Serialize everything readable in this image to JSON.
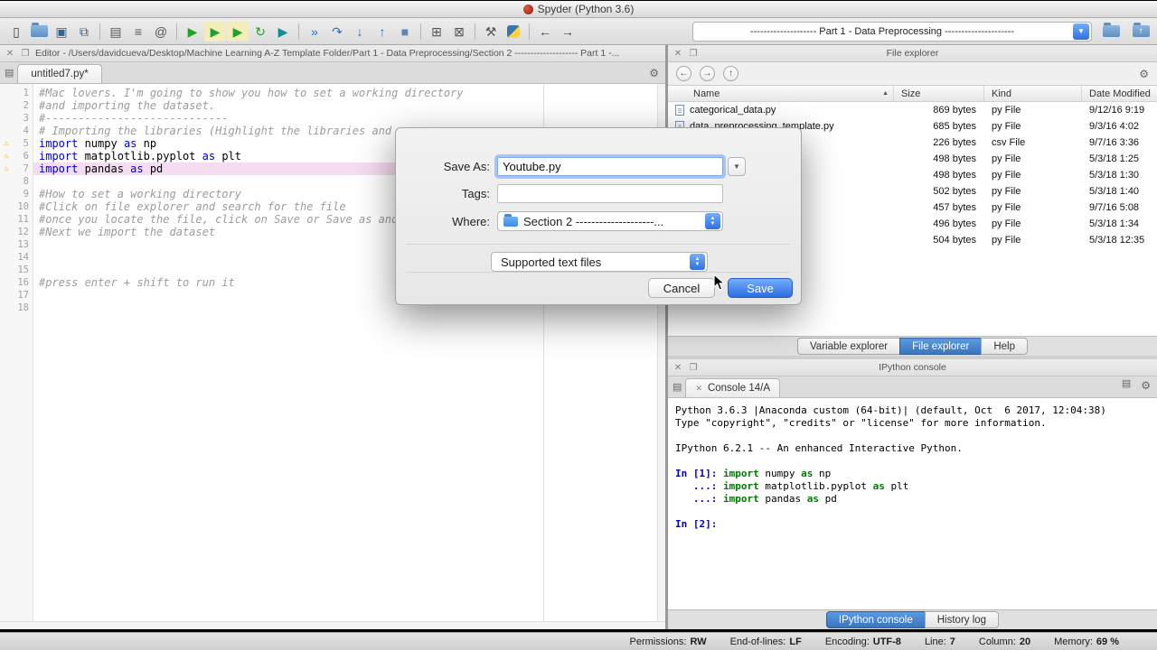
{
  "title_bar": {
    "title": "Spyder (Python 3.6)"
  },
  "colors": {
    "active_tab_blue": "#3a74bd",
    "save_button_blue": "#2d6ce2",
    "highlight_pink": "#f6dcf0",
    "warning_yellow": "#edb200",
    "keyword_blue": "#0000c8",
    "comment_gray": "#9c9c9c",
    "console_keyword_green": "#007a00",
    "prompt_blue": "#0000c8"
  },
  "toolbar": {
    "workdir_combo": "-------------------- Part 1 - Data Preprocessing ---------------------",
    "icons": [
      {
        "name": "new-file-icon",
        "glyph": "▯",
        "color": "#444"
      },
      {
        "name": "open-file-icon",
        "type": "folder"
      },
      {
        "name": "save-icon",
        "glyph": "▣",
        "color": "#33628e"
      },
      {
        "name": "save-all-icon",
        "glyph": "⧉",
        "color": "#33628e"
      },
      {
        "type": "sep"
      },
      {
        "name": "print-icon",
        "glyph": "▤",
        "color": "#555"
      },
      {
        "name": "file-switcher-icon",
        "glyph": "≡",
        "color": "#555"
      },
      {
        "name": "find-in-files-icon",
        "glyph": "@",
        "color": "#555"
      },
      {
        "type": "sep"
      },
      {
        "name": "run-icon",
        "glyph": "▶",
        "color": "#23a127"
      },
      {
        "name": "run-cell-icon",
        "glyph": "▶",
        "color": "#23a127",
        "bg": "#f3edbb"
      },
      {
        "name": "run-cell-advance-icon",
        "glyph": "▶",
        "color": "#23a127",
        "bg": "#f3edbb"
      },
      {
        "name": "rerun-cell-icon",
        "glyph": "↻",
        "color": "#23a127"
      },
      {
        "name": "run-selection-icon",
        "glyph": "▶",
        "color": "#0f8f94"
      },
      {
        "type": "sep"
      },
      {
        "name": "debug-icon",
        "glyph": "»",
        "color": "#2d6fc3"
      },
      {
        "name": "debug-step-icon",
        "glyph": "↷",
        "color": "#2d6fc3"
      },
      {
        "name": "debug-step-into-icon",
        "glyph": "↓",
        "color": "#2d6fc3"
      },
      {
        "name": "debug-step-out-icon",
        "glyph": "↑",
        "color": "#2d6fc3"
      },
      {
        "name": "stop-icon",
        "glyph": "■",
        "color": "#5c87b5"
      },
      {
        "type": "sep"
      },
      {
        "name": "maximize-pane-icon",
        "glyph": "⊞",
        "color": "#555"
      },
      {
        "name": "close-pane-icon",
        "glyph": "⊠",
        "color": "#555"
      },
      {
        "type": "sep"
      },
      {
        "name": "preferences-icon",
        "glyph": "⚒",
        "color": "#555"
      },
      {
        "name": "python-path-icon",
        "type": "pylogo"
      },
      {
        "type": "sep"
      },
      {
        "name": "back-icon",
        "glyph": "←",
        "color": "#444"
      },
      {
        "name": "forward-icon",
        "glyph": "→",
        "color": "#444"
      }
    ]
  },
  "editor": {
    "header": "Editor - /Users/davidcueva/Desktop/Machine Learning A-Z Template Folder/Part 1 - Data Preprocessing/Section 2 -------------------- Part 1 -...",
    "tab": "untitled7.py*",
    "lines": [
      {
        "n": 1,
        "seg": [
          [
            "c",
            "#Mac lovers. I'm going to show you how to set a working directory"
          ]
        ]
      },
      {
        "n": 2,
        "seg": [
          [
            "c",
            "#and importing the dataset."
          ]
        ]
      },
      {
        "n": 3,
        "seg": [
          [
            "c",
            "#----------------------------"
          ]
        ]
      },
      {
        "n": 4,
        "seg": [
          [
            "c",
            "# Importing the libraries (Highlight the libraries and p"
          ]
        ]
      },
      {
        "n": 5,
        "w": true,
        "seg": [
          [
            "k",
            "import"
          ],
          [
            "p",
            " numpy "
          ],
          [
            "k",
            "as"
          ],
          [
            "p",
            " np"
          ]
        ]
      },
      {
        "n": 6,
        "w": true,
        "seg": [
          [
            "k",
            "import"
          ],
          [
            "p",
            " matplotlib.pyplot "
          ],
          [
            "k",
            "as"
          ],
          [
            "p",
            " plt"
          ]
        ]
      },
      {
        "n": 7,
        "w": true,
        "h": true,
        "seg": [
          [
            "k",
            "import"
          ],
          [
            "p",
            " pandas "
          ],
          [
            "k",
            "as"
          ],
          [
            "p",
            " pd"
          ]
        ]
      },
      {
        "n": 8,
        "seg": []
      },
      {
        "n": 9,
        "seg": [
          [
            "c",
            "#How to set a working directory"
          ]
        ]
      },
      {
        "n": 10,
        "seg": [
          [
            "c",
            "#Click on file explorer and search for the file"
          ]
        ]
      },
      {
        "n": 11,
        "seg": [
          [
            "c",
            "#once you locate the file, click on Save or Save as and"
          ]
        ]
      },
      {
        "n": 12,
        "seg": [
          [
            "c",
            "#Next we import the dataset"
          ]
        ]
      },
      {
        "n": 13,
        "seg": []
      },
      {
        "n": 14,
        "seg": []
      },
      {
        "n": 15,
        "seg": []
      },
      {
        "n": 16,
        "seg": [
          [
            "c",
            "#press enter + shift to run it"
          ]
        ]
      },
      {
        "n": 17,
        "seg": []
      },
      {
        "n": 18,
        "seg": []
      }
    ]
  },
  "file_explorer": {
    "panel_title": "File explorer",
    "toolbar_icons": [
      {
        "name": "explorer-previous-icon",
        "glyph": "←"
      },
      {
        "name": "explorer-next-icon",
        "glyph": "→"
      },
      {
        "name": "explorer-parent-icon",
        "glyph": "↑"
      }
    ],
    "columns": [
      "Name",
      "Size",
      "Kind",
      "Date Modified"
    ],
    "rows": [
      {
        "name": "categorical_data.py",
        "size": "869 bytes",
        "kind": "py File",
        "date": "9/12/16 9:19"
      },
      {
        "name": "data_preprocessing_template.py",
        "size": "685 bytes",
        "kind": "py File",
        "date": "9/3/16 4:02"
      },
      {
        "name": "",
        "size": "226 bytes",
        "kind": "csv File",
        "date": "9/7/16 3:36"
      },
      {
        "name": "",
        "size": "498 bytes",
        "kind": "py File",
        "date": "5/3/18 1:25"
      },
      {
        "name": "",
        "size": "498 bytes",
        "kind": "py File",
        "date": "5/3/18 1:30"
      },
      {
        "name": "",
        "size": "502 bytes",
        "kind": "py File",
        "date": "5/3/18 1:40"
      },
      {
        "name": "",
        "size": "457 bytes",
        "kind": "py File",
        "date": "9/7/16 5:08"
      },
      {
        "name": "",
        "size": "496 bytes",
        "kind": "py File",
        "date": "5/3/18 1:34"
      },
      {
        "name": "",
        "size": "504 bytes",
        "kind": "py File",
        "date": "5/3/18 12:35"
      }
    ],
    "tabs": [
      {
        "label": "Variable explorer",
        "active": false
      },
      {
        "label": "File explorer",
        "active": true
      },
      {
        "label": "Help",
        "active": false
      }
    ]
  },
  "console": {
    "panel_title": "IPython console",
    "tab": "Console 14/A",
    "lines": [
      [
        [
          "p",
          "Python 3.6.3 |Anaconda custom (64-bit)| (default, Oct  6 2017, 12:04:38)"
        ]
      ],
      [
        [
          "p",
          "Type \"copyright\", \"credits\" or \"license\" for more information."
        ]
      ],
      [],
      [
        [
          "p",
          "IPython 6.2.1 -- An enhanced Interactive Python."
        ]
      ],
      [],
      [
        [
          "in",
          "In [1]: "
        ],
        [
          "k",
          "import"
        ],
        [
          "p",
          " numpy "
        ],
        [
          "k",
          "as"
        ],
        [
          "p",
          " np"
        ]
      ],
      [
        [
          "in",
          "   ...: "
        ],
        [
          "k",
          "import"
        ],
        [
          "p",
          " matplotlib.pyplot "
        ],
        [
          "k",
          "as"
        ],
        [
          "p",
          " plt"
        ]
      ],
      [
        [
          "in",
          "   ...: "
        ],
        [
          "k",
          "import"
        ],
        [
          "p",
          " pandas "
        ],
        [
          "k",
          "as"
        ],
        [
          "p",
          " pd"
        ]
      ],
      [],
      [
        [
          "in",
          "In [2]: "
        ]
      ]
    ],
    "tabs": [
      {
        "label": "IPython console",
        "active": true
      },
      {
        "label": "History log",
        "active": false
      }
    ]
  },
  "dialog": {
    "save_as_label": "Save As:",
    "filename": "Youtube.py",
    "tags_label": "Tags:",
    "tags_value": "",
    "where_label": "Where:",
    "where_value": "Section 2 --------------------...",
    "filetype": "Supported text files",
    "cancel_label": "Cancel",
    "save_label": "Save"
  },
  "status_bar": {
    "items": [
      {
        "label": "Permissions:",
        "value": "RW"
      },
      {
        "label": "End-of-lines:",
        "value": "LF"
      },
      {
        "label": "Encoding:",
        "value": "UTF-8"
      },
      {
        "label": "Line:",
        "value": "7"
      },
      {
        "label": "Column:",
        "value": "20"
      },
      {
        "label": "Memory:",
        "value": "69 %"
      }
    ]
  }
}
